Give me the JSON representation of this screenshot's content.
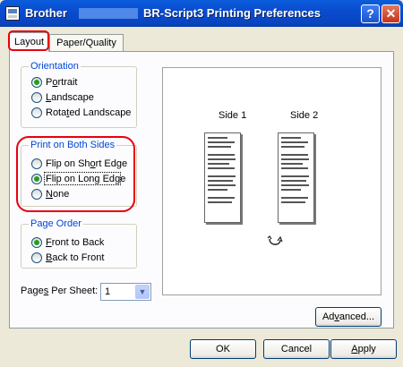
{
  "window": {
    "title_brand": "Brother",
    "title_model": "BR-Script3 Printing Preferences",
    "help_label": "?",
    "close_label": "✕"
  },
  "tabs": [
    {
      "label": "Layout",
      "active": true
    },
    {
      "label": "Paper/Quality",
      "active": false
    }
  ],
  "orientation": {
    "title": "Orientation",
    "options": [
      {
        "pre": "P",
        "u": "o",
        "post": "rtrait",
        "checked": true
      },
      {
        "pre": "",
        "u": "L",
        "post": "andscape",
        "checked": false
      },
      {
        "pre": "Rota",
        "u": "t",
        "post": "ed Landscape",
        "checked": false
      }
    ]
  },
  "both_sides": {
    "title": "Print on Both Sides",
    "options": [
      {
        "pre": "Flip on Sh",
        "u": "o",
        "post": "rt Edge",
        "checked": false
      },
      {
        "pre": "Flip on Long Ed",
        "u": "g",
        "post": "e",
        "checked": true
      },
      {
        "pre": "",
        "u": "N",
        "post": "one",
        "checked": false
      }
    ]
  },
  "page_order": {
    "title": "Page Order",
    "options": [
      {
        "pre": "",
        "u": "F",
        "post": "ront to Back",
        "checked": true
      },
      {
        "pre": "",
        "u": "B",
        "post": "ack to Front",
        "checked": false
      }
    ]
  },
  "pages_per_sheet": {
    "label_pre": "Page",
    "label_u": "s",
    "label_post": " Per Sheet:",
    "value": "1",
    "arrow": "▼"
  },
  "preview": {
    "side1": "Side 1",
    "side2": "Side 2",
    "flip_icon": "rotate-arrow-icon"
  },
  "buttons": {
    "advanced_pre": "Ad",
    "advanced_u": "v",
    "advanced_post": "anced...",
    "ok": "OK",
    "cancel": "Cancel",
    "apply_u": "A",
    "apply_post": "pply"
  },
  "colors": {
    "group_title": "#0046d5",
    "highlight": "#e8000e",
    "radio_dot": "#21a121",
    "titlebar": "#0a4ccf"
  }
}
